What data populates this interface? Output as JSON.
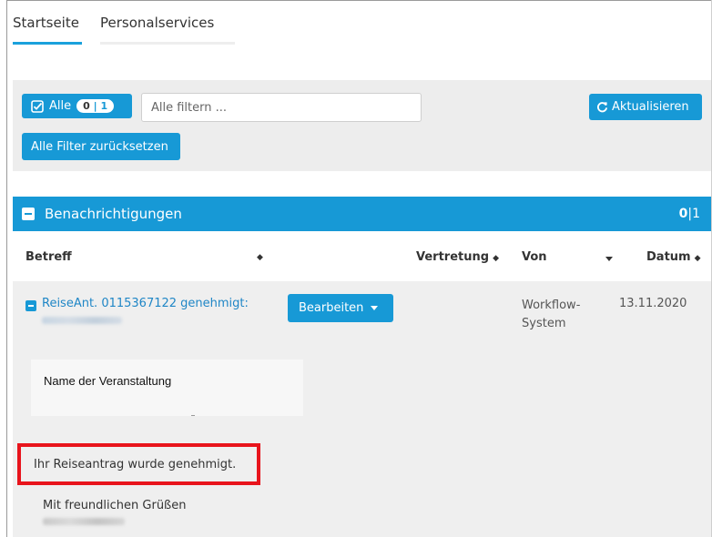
{
  "tabs": [
    {
      "label": "Startseite",
      "active": true
    },
    {
      "label": "Personalservices",
      "active": false
    }
  ],
  "filter": {
    "all_label": "Alle",
    "badge_selected": "0",
    "badge_total": "1",
    "badge_separator": "|",
    "search_placeholder": "Alle filtern ...",
    "refresh_label": "Aktualisieren",
    "reset_label": "Alle Filter zurücksetzen"
  },
  "notifications": {
    "title": "Benachrichtigungen",
    "count_selected": "0",
    "count_total": "1",
    "count_separator": "|"
  },
  "table": {
    "columns": {
      "subject": "Betreff",
      "deputy": "Vertretung",
      "from": "Von",
      "date": "Datum"
    },
    "rows": [
      {
        "subject": "ReiseAnt. 0115367122 genehmigt:",
        "action_label": "Bearbeiten",
        "from": "Workflow-System",
        "date": "13.11.2020",
        "detail": {
          "event_title": "Name der Veranstaltung",
          "approved_text": "Ihr Reiseantrag wurde genehmigt.",
          "regards": "Mit freundlichen Grüßen"
        }
      }
    ]
  },
  "colors": {
    "accent": "#1799d6",
    "highlight": "#e8141c",
    "link": "#1f86c6"
  }
}
